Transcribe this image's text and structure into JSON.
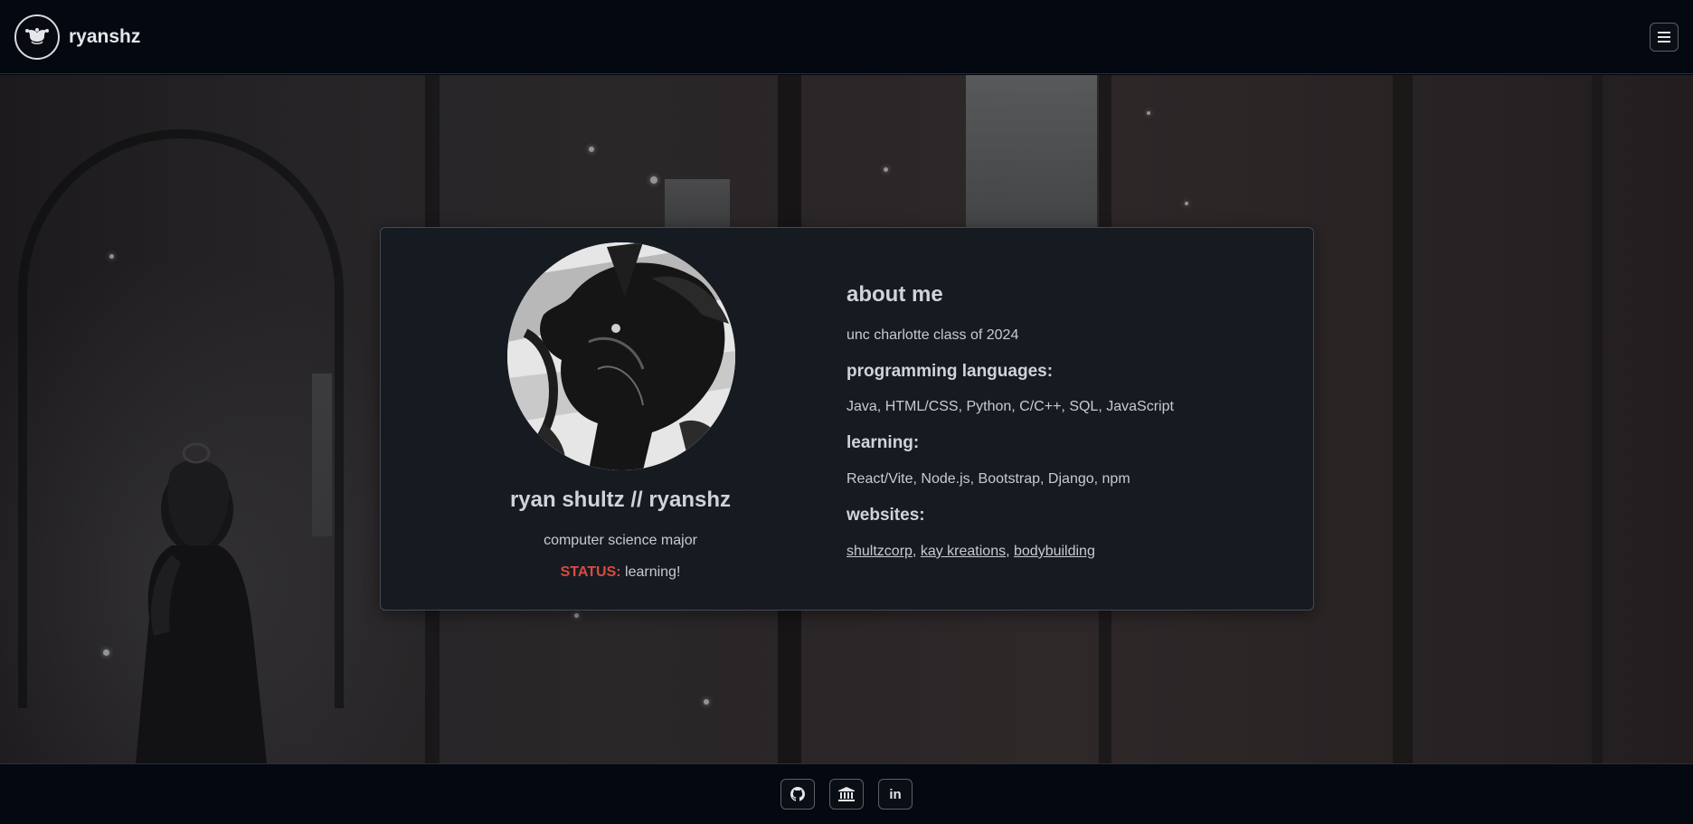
{
  "navbar": {
    "brand_name": "ryanshz",
    "logo_icon": "jester-hat-icon",
    "menu_icon": "hamburger-menu-icon"
  },
  "profile": {
    "avatar_alt": "dragon illustration avatar",
    "name": "ryan shultz // ryanshz",
    "major": "computer science major",
    "status_label": "STATUS:",
    "status_value": "learning!"
  },
  "about": {
    "title": "about me",
    "school": "unc charlotte class of 2024",
    "languages_heading": "programming languages:",
    "languages": "Java, HTML/CSS, Python, C/C++, SQL, JavaScript",
    "learning_heading": "learning:",
    "learning": "React/Vite, Node.js, Bootstrap, Django, npm",
    "websites_heading": "websites:",
    "websites": [
      {
        "label": "shultzcorp"
      },
      {
        "label": "kay kreations"
      },
      {
        "label": "bodybuilding"
      }
    ],
    "separator": ","
  },
  "footer": {
    "social": [
      {
        "icon": "github-icon"
      },
      {
        "icon": "institution-icon"
      },
      {
        "icon": "linkedin-icon",
        "text": "in"
      }
    ]
  },
  "colors": {
    "background": "#03060b",
    "card": "#161b22",
    "status_accent": "#d94b3f",
    "text": "#c7cbd1"
  }
}
